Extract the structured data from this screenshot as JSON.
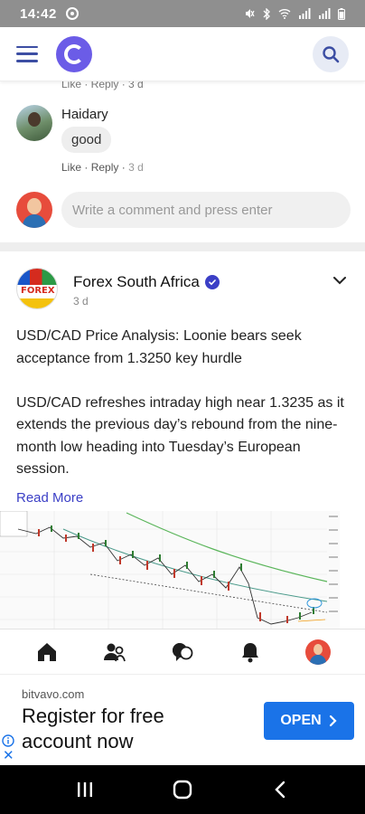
{
  "status_bar": {
    "time": "14:42"
  },
  "previous_comment": {
    "actions": "Like · Reply · 3 d"
  },
  "comment": {
    "author": "Haidary",
    "text": "good",
    "like_label": "Like",
    "reply_label": "Reply",
    "time": "3 d"
  },
  "composer": {
    "placeholder": "Write a comment and press enter"
  },
  "post": {
    "author": "Forex South Africa",
    "avatar_text": "FOREX",
    "time": "3 d",
    "text": "USD/CAD Price Analysis: Loonie bears seek acceptance from 1.3250 key hurdle\n\nUSD/CAD refreshes intraday high near 1.3235 as it extends the previous day’s rebound from the nine-month low heading into Tuesday’s European session.",
    "read_more": "Read More"
  },
  "bottom_nav": {
    "items": [
      "home-icon",
      "people-icon",
      "chat-icon",
      "bell-icon",
      "profile-avatar"
    ]
  },
  "ad": {
    "domain": "bitvavo.com",
    "headline": "Register for free account now",
    "cta": "OPEN"
  },
  "colors": {
    "accent": "#3b3fc6",
    "brand_logo": "#6b5ce7",
    "ad_button": "#1a73e8",
    "status_bar": "#8f8f8f"
  }
}
